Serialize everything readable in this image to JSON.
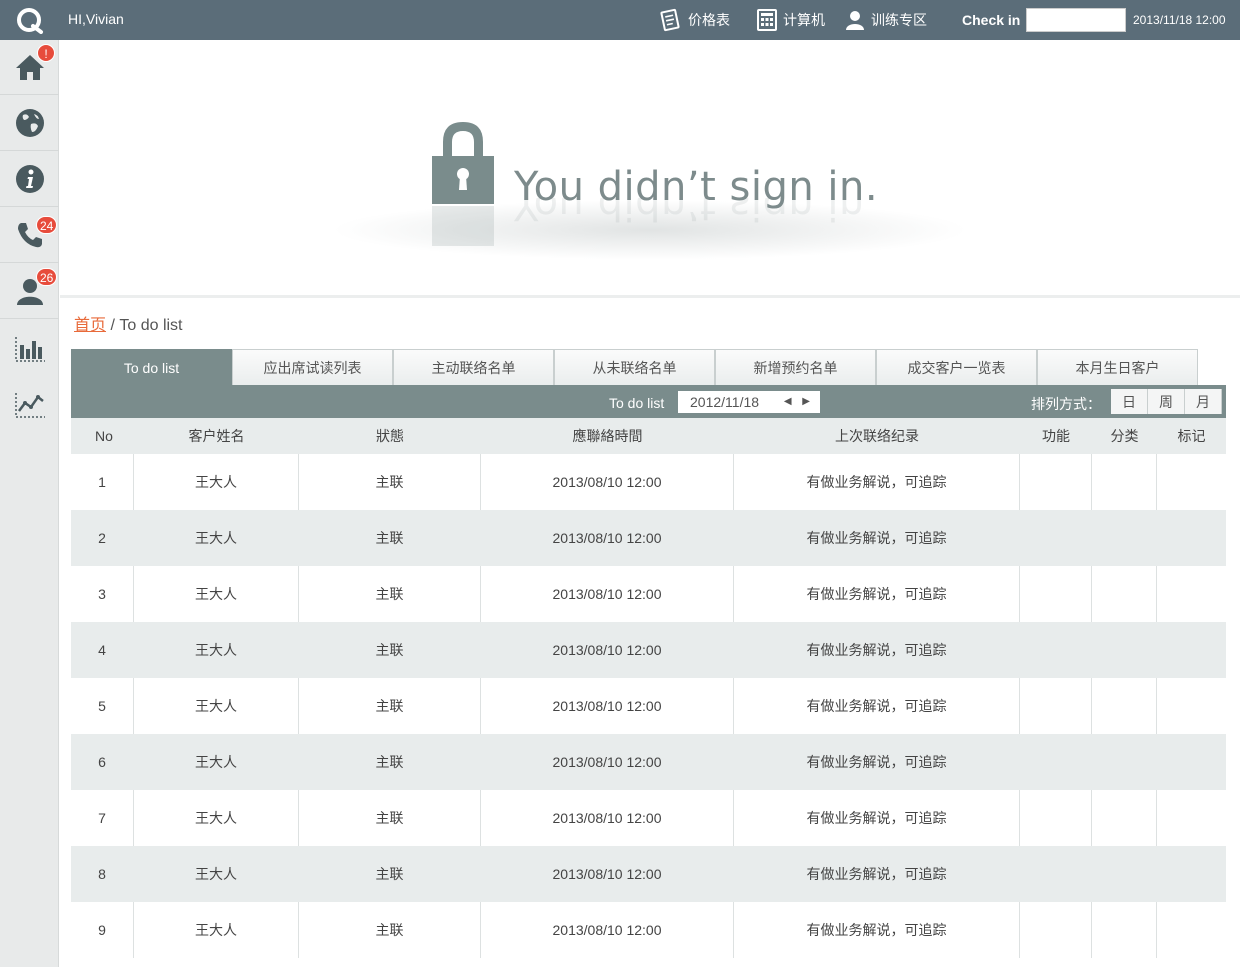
{
  "header": {
    "greeting": "HI,Vivian",
    "nav": [
      {
        "label": "价格表",
        "icon": "price-list-icon"
      },
      {
        "label": "计算机",
        "icon": "calculator-icon"
      },
      {
        "label": "训练专区",
        "icon": "user-icon"
      }
    ],
    "checkin_label": "Check in",
    "checkin_value": "",
    "datetime": "2013/11/18 12:00"
  },
  "sidebar": {
    "items": [
      {
        "icon": "home-icon",
        "badge": "!"
      },
      {
        "icon": "globe-icon",
        "badge": ""
      },
      {
        "icon": "info-icon",
        "badge": ""
      },
      {
        "icon": "phone-icon",
        "badge": "24"
      },
      {
        "icon": "person-icon",
        "badge": "26"
      },
      {
        "icon": "bar-chart-icon",
        "badge": ""
      },
      {
        "icon": "line-chart-icon",
        "badge": ""
      }
    ]
  },
  "hero": {
    "message": "You didn’t sign in."
  },
  "breadcrumb": {
    "home": "首页",
    "separator": " / ",
    "current": "To do list"
  },
  "tabs": [
    "To do list",
    "应出席试读列表",
    "主动联络名单",
    "从未联络名单",
    "新增预约名单",
    "成交客户一览表",
    "本月生日客户"
  ],
  "filter": {
    "label": "To do list",
    "date": "2012/11/18",
    "arrows": "◀ ▶",
    "sort_label": "排列方式：",
    "sort_options": [
      "日",
      "周",
      "月"
    ]
  },
  "table": {
    "columns": [
      "No",
      "客户姓名",
      "狀態",
      "應聯絡時間",
      "上次联络纪录",
      "功能",
      "分类",
      "标记"
    ],
    "rows": [
      [
        "1",
        "王大人",
        "主联",
        "2013/08/10 12:00",
        "有做业务解说，可追踪",
        "",
        "",
        ""
      ],
      [
        "2",
        "王大人",
        "主联",
        "2013/08/10 12:00",
        "有做业务解说，可追踪",
        "",
        "",
        ""
      ],
      [
        "3",
        "王大人",
        "主联",
        "2013/08/10 12:00",
        "有做业务解说，可追踪",
        "",
        "",
        ""
      ],
      [
        "4",
        "王大人",
        "主联",
        "2013/08/10 12:00",
        "有做业务解说，可追踪",
        "",
        "",
        ""
      ],
      [
        "5",
        "王大人",
        "主联",
        "2013/08/10 12:00",
        "有做业务解说，可追踪",
        "",
        "",
        ""
      ],
      [
        "6",
        "王大人",
        "主联",
        "2013/08/10 12:00",
        "有做业务解说，可追踪",
        "",
        "",
        ""
      ],
      [
        "7",
        "王大人",
        "主联",
        "2013/08/10 12:00",
        "有做业务解说，可追踪",
        "",
        "",
        ""
      ],
      [
        "8",
        "王大人",
        "主联",
        "2013/08/10 12:00",
        "有做业务解说，可追踪",
        "",
        "",
        ""
      ],
      [
        "9",
        "王大人",
        "主联",
        "2013/08/10 12:00",
        "有做业务解说，可追踪",
        "",
        "",
        ""
      ]
    ]
  },
  "colors": {
    "topbar": "#5b6d79",
    "accent": "#7a8c8c",
    "badge": "#e74c3c",
    "link": "#e86a3a"
  }
}
